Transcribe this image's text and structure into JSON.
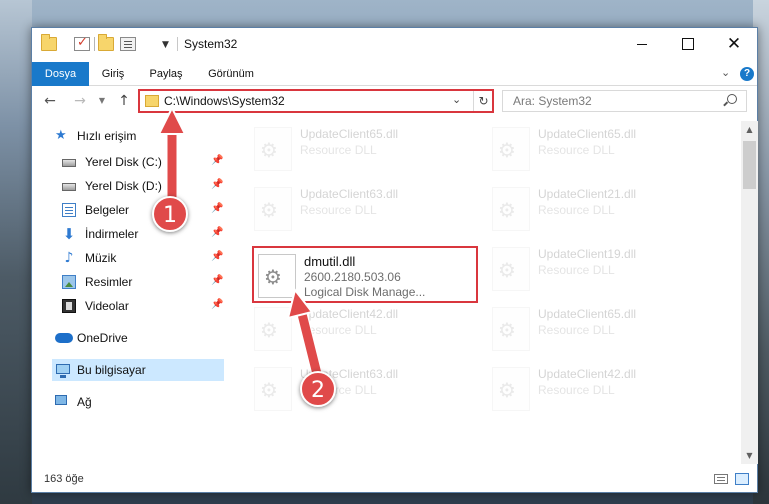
{
  "window": {
    "title": "System32"
  },
  "ribbon": {
    "tabs": [
      "Dosya",
      "Giriş",
      "Paylaş",
      "Görünüm"
    ],
    "help": "?"
  },
  "address": {
    "path": "C:\\Windows\\System32",
    "search_placeholder": "Ara: System32"
  },
  "sidebar": {
    "quick_access": "Hızlı erişim",
    "items": [
      {
        "label": "Yerel Disk (C:)",
        "icon": "disk-icon",
        "pinned": true
      },
      {
        "label": "Yerel Disk (D:)",
        "icon": "disk-icon",
        "pinned": true
      },
      {
        "label": "Belgeler",
        "icon": "documents-icon",
        "pinned": true
      },
      {
        "label": "İndirmeler",
        "icon": "downloads-icon",
        "pinned": true
      },
      {
        "label": "Müzik",
        "icon": "music-icon",
        "pinned": true
      },
      {
        "label": "Resimler",
        "icon": "pictures-icon",
        "pinned": true
      },
      {
        "label": "Videolar",
        "icon": "videos-icon",
        "pinned": true
      }
    ],
    "onedrive": "OneDrive",
    "this_pc": "Bu bilgisayar",
    "network": "Ağ"
  },
  "files": [
    {
      "name": "UpdateClient65.dll",
      "type": "Resource DLL",
      "faded": true
    },
    {
      "name": "UpdateClient65.dll",
      "type": "Resource DLL",
      "faded": true
    },
    {
      "name": "UpdateClient63.dll",
      "type": "Resource DLL",
      "faded": true
    },
    {
      "name": "UpdateClient21.dll",
      "type": "Resource DLL",
      "faded": true
    },
    {
      "name": "dmutil.dll",
      "version": "2600.2180.503.06",
      "description": "Logical Disk Manage...",
      "faded": false
    },
    {
      "name": "UpdateClient19.dll",
      "type": "Resource DLL",
      "faded": true
    },
    {
      "name": "UpdateClient42.dll",
      "type": "Resource DLL",
      "faded": true
    },
    {
      "name": "UpdateClient65.dll",
      "type": "Resource DLL",
      "faded": true
    },
    {
      "name": "UpdateClient63.dll",
      "type": "Resource DLL",
      "faded": true
    },
    {
      "name": "UpdateClient42.dll",
      "type": "Resource DLL",
      "faded": true
    }
  ],
  "status": {
    "item_count": "163 öğe"
  },
  "annotations": {
    "step1": "1",
    "step2": "2",
    "color": "#e04a4a"
  }
}
